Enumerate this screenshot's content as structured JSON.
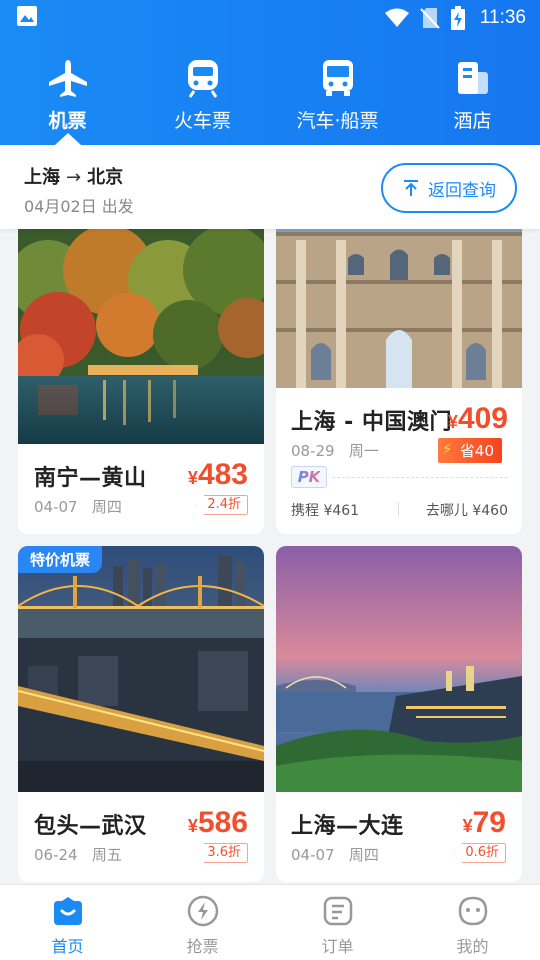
{
  "status": {
    "time": "11:36"
  },
  "tabs": [
    {
      "label": "机票",
      "icon": "plane-icon",
      "active": true
    },
    {
      "label": "火车票",
      "icon": "train-icon"
    },
    {
      "label": "汽车·船票",
      "icon": "bus-icon"
    },
    {
      "label": "酒店",
      "icon": "hotel-icon"
    }
  ],
  "route": {
    "from": "上海",
    "arrow": "→",
    "to": "北京",
    "date": "04月02日 出发",
    "back_label": "返回查询"
  },
  "cards": [
    {
      "title": "南宁—黄山",
      "date": "04-07",
      "weekday": "周四",
      "yen": "¥",
      "price": "483",
      "discount": "2.4折"
    },
    {
      "title": "上海 - 中国澳门",
      "date": "08-29",
      "weekday": "周一",
      "yen": "¥",
      "price": "409",
      "save": "省40",
      "pk": "PK",
      "compare1": "携程 ¥461",
      "compare2": "去哪儿 ¥460"
    },
    {
      "badge": "特价机票",
      "title": "包头—武汉",
      "date": "06-24",
      "weekday": "周五",
      "yen": "¥",
      "price": "586",
      "discount": "3.6折"
    },
    {
      "title": "上海—大连",
      "date": "04-07",
      "weekday": "周四",
      "yen": "¥",
      "price": "79",
      "discount": "0.6折"
    }
  ],
  "bottom_nav": [
    {
      "label": "首页",
      "icon": "home-icon",
      "active": true
    },
    {
      "label": "抢票",
      "icon": "lightning-icon"
    },
    {
      "label": "订单",
      "icon": "order-icon"
    },
    {
      "label": "我的",
      "icon": "profile-icon"
    }
  ],
  "colors": {
    "brand": "#1a8bf5",
    "price": "#f24e2c"
  }
}
